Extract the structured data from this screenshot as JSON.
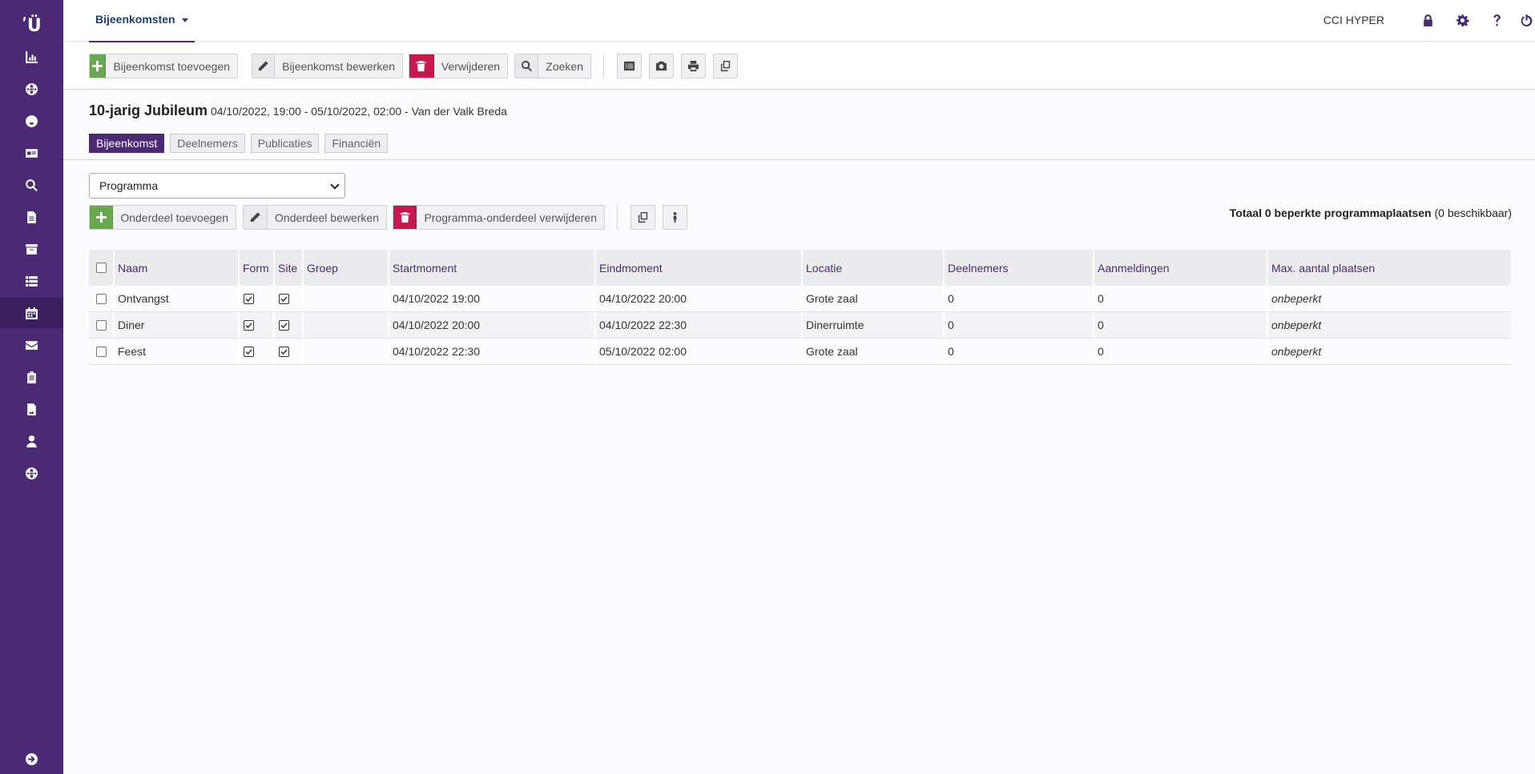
{
  "sidebar": {
    "logo": "ʹÜ",
    "items": [
      {
        "icon": "chart-icon"
      },
      {
        "icon": "globe-icon"
      },
      {
        "icon": "smiley-icon"
      },
      {
        "icon": "id-card-icon"
      },
      {
        "icon": "search-icon"
      },
      {
        "icon": "document-icon"
      },
      {
        "icon": "archive-icon"
      },
      {
        "icon": "list-icon"
      },
      {
        "icon": "calendar-icon"
      },
      {
        "icon": "envelope-icon"
      },
      {
        "icon": "clipboard-icon"
      },
      {
        "icon": "image-file-icon"
      },
      {
        "icon": "user-icon"
      },
      {
        "icon": "globe-icon"
      }
    ],
    "bottom_icon": "arrow-right-circle-icon"
  },
  "topbar": {
    "tab_label": "Bijeenkomsten",
    "org_name": "CCI HYPER",
    "icons": [
      "lock-icon",
      "gear-icon",
      "help-icon",
      "power-icon"
    ]
  },
  "toolbar": {
    "add_label": "Bijeenkomst toevoegen",
    "edit_label": "Bijeenkomst bewerken",
    "delete_label": "Verwijderen",
    "search_label": "Zoeken"
  },
  "event": {
    "title": "10-jarig Jubileum",
    "details": "04/10/2022, 19:00 - 05/10/2022, 02:00 - Van der Valk Breda"
  },
  "subtabs": [
    "Bijeenkomst",
    "Deelnemers",
    "Publicaties",
    "Financiën"
  ],
  "select": {
    "value": "Programma"
  },
  "program_toolbar": {
    "add_label": "Onderdeel toevoegen",
    "edit_label": "Onderdeel bewerken",
    "delete_label": "Programma-onderdeel verwijderen"
  },
  "totaal": {
    "bold": "Totaal 0 beperkte programmaplaatsen",
    "rest": " (0 beschikbaar)"
  },
  "table": {
    "headers": [
      "Naam",
      "Form",
      "Site",
      "Groep",
      "Startmoment",
      "Eindmoment",
      "Locatie",
      "Deelnemers",
      "Aanmeldingen",
      "Max. aantal plaatsen"
    ],
    "rows": [
      {
        "naam": "Ontvangst",
        "form": true,
        "site": true,
        "groep": "",
        "start": "04/10/2022 19:00",
        "eind": "04/10/2022 20:00",
        "locatie": "Grote zaal",
        "deelnemers": "0",
        "aanmeldingen": "0",
        "max": "onbeperkt"
      },
      {
        "naam": "Diner",
        "form": true,
        "site": true,
        "groep": "",
        "start": "04/10/2022 20:00",
        "eind": "04/10/2022 22:30",
        "locatie": "Dinerruimte",
        "deelnemers": "0",
        "aanmeldingen": "0",
        "max": "onbeperkt"
      },
      {
        "naam": "Feest",
        "form": true,
        "site": true,
        "groep": "",
        "start": "04/10/2022 22:30",
        "eind": "05/10/2022 02:00",
        "locatie": "Grote zaal",
        "deelnemers": "0",
        "aanmeldingen": "0",
        "max": "onbeperkt"
      }
    ]
  }
}
